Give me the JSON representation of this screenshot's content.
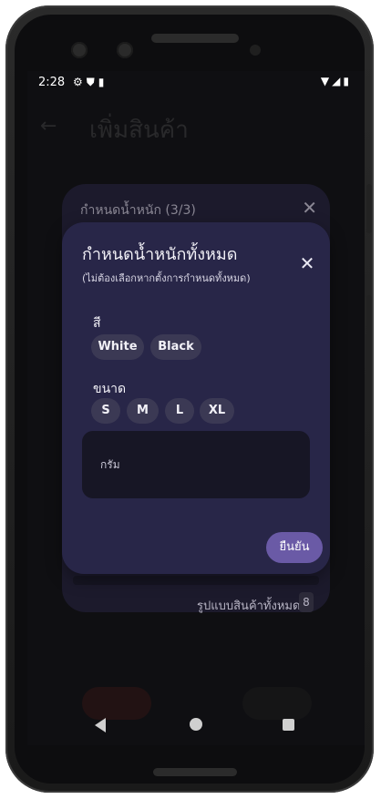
{
  "statusbar": {
    "time": "2:28",
    "icons_left": [
      "gear-icon",
      "shield-icon",
      "sd-card-icon"
    ],
    "icons_right": [
      "wifi-icon",
      "signal-icon",
      "battery-icon"
    ]
  },
  "background_page": {
    "title": "เพิ่มสินค้า"
  },
  "back_sheet": {
    "title": "กำหนดน้ำหนัก",
    "step": "(3/3)",
    "footer_label": "รูปแบบสินค้าทั้งหมด",
    "footer_count": "8"
  },
  "dialog": {
    "title": "กำหนดน้ำหนักทั้งหมด",
    "subtitle": "(ไม่ต้องเลือกหากตั้งการกำหนดทั้งหมด)",
    "color_label": "สี",
    "colors": [
      "White",
      "Black"
    ],
    "size_label": "ขนาด",
    "sizes": [
      "S",
      "M",
      "L",
      "XL"
    ],
    "weight_placeholder": "กรัม",
    "confirm_label": "ยืนยัน"
  },
  "colors": {
    "dialog_bg": "#282648",
    "chip_bg": "#3b3954",
    "confirm_bg": "#6a5aa6"
  }
}
